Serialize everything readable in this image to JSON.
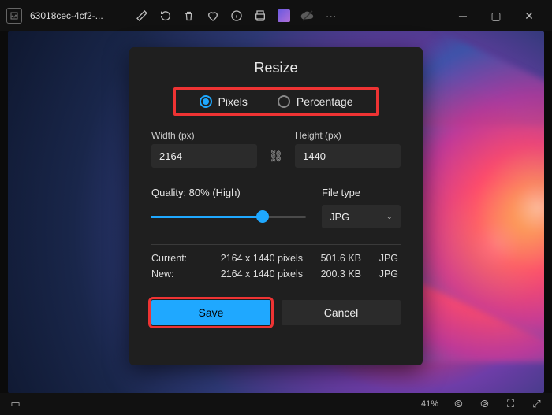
{
  "titlebar": {
    "filename": "63018cec-4cf2-..."
  },
  "dialog": {
    "title": "Resize",
    "units": {
      "pixels": "Pixels",
      "percentage": "Percentage"
    },
    "width_label": "Width  (px)",
    "height_label": "Height  (px)",
    "width_value": "2164",
    "height_value": "1440",
    "quality_label": "Quality: 80% (High)",
    "filetype_label": "File type",
    "filetype_value": "JPG",
    "info": {
      "current_label": "Current:",
      "new_label": "New:",
      "current_dims": "2164 x 1440 pixels",
      "current_size": "501.6 KB",
      "current_type": "JPG",
      "new_dims": "2164 x 1440 pixels",
      "new_size": "200.3 KB",
      "new_type": "JPG"
    },
    "save": "Save",
    "cancel": "Cancel"
  },
  "status": {
    "zoom": "41%"
  }
}
